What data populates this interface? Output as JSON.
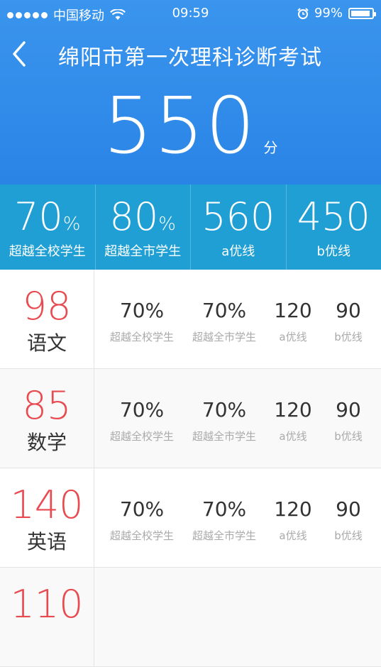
{
  "status_bar": {
    "carrier": "中国移动",
    "time": "09:59",
    "battery": "99%"
  },
  "header": {
    "title": "绵阳市第一次理科诊断考试",
    "total_score": "550",
    "score_unit": "分"
  },
  "summary": [
    {
      "value": "70",
      "suffix": "%",
      "label": "超越全校学生"
    },
    {
      "value": "80",
      "suffix": "%",
      "label": "超越全市学生"
    },
    {
      "value": "560",
      "suffix": "",
      "label": "a优线"
    },
    {
      "value": "450",
      "suffix": "",
      "label": "b优线"
    }
  ],
  "subjects": [
    {
      "score": "98",
      "name": "语文",
      "school_pct": "70%",
      "school_label": "超越全校学生",
      "city_pct": "70%",
      "city_label": "超越全市学生",
      "a_line": "120",
      "a_label": "a优线",
      "b_line": "90",
      "b_label": "b优线"
    },
    {
      "score": "85",
      "name": "数学",
      "school_pct": "70%",
      "school_label": "超越全校学生",
      "city_pct": "70%",
      "city_label": "超越全市学生",
      "a_line": "120",
      "a_label": "a优线",
      "b_line": "90",
      "b_label": "b优线"
    },
    {
      "score": "140",
      "name": "英语",
      "school_pct": "70%",
      "school_label": "超越全校学生",
      "city_pct": "70%",
      "city_label": "超越全市学生",
      "a_line": "120",
      "a_label": "a优线",
      "b_line": "90",
      "b_label": "b优线"
    },
    {
      "score": "110",
      "name": "",
      "school_pct": "",
      "school_label": "",
      "city_pct": "",
      "city_label": "",
      "a_line": "",
      "a_label": "",
      "b_line": "",
      "b_label": ""
    }
  ],
  "colors": {
    "header_blue": "#2f8cea",
    "summary_blue": "#1f9fd3",
    "score_red": "#e84a4f"
  }
}
